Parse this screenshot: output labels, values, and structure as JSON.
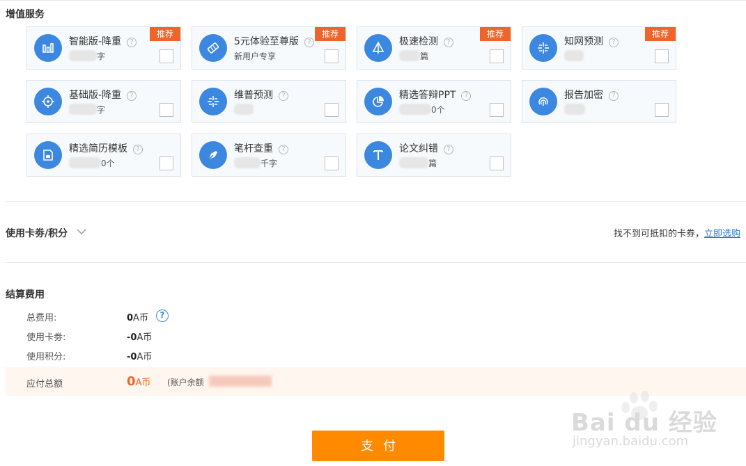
{
  "value_added": {
    "title": "增值服务",
    "services": [
      {
        "name": "智能版-降重",
        "sub": "字",
        "badge": "推荐",
        "icon": "bar-chart-icon"
      },
      {
        "name": "5元体验至尊版",
        "sub": "新用户专享",
        "badge": "推荐",
        "icon": "ticket-icon"
      },
      {
        "name": "极速检测",
        "sub": "篇",
        "badge": "推荐",
        "icon": "sail-icon"
      },
      {
        "name": "知网预测",
        "sub": "",
        "badge": "推荐",
        "icon": "compass-grid-icon"
      },
      {
        "name": "基础版-降重",
        "sub": "字",
        "badge": "",
        "icon": "crosshair-icon"
      },
      {
        "name": "维普预测",
        "sub": "",
        "badge": "",
        "icon": "compass-grid-icon"
      },
      {
        "name": "精选答辩PPT",
        "sub": "0个",
        "badge": "",
        "icon": "pie-chart-icon"
      },
      {
        "name": "报告加密",
        "sub": "",
        "badge": "",
        "icon": "fingerprint-icon"
      },
      {
        "name": "精选简历模板",
        "sub": "0个",
        "badge": "",
        "icon": "document-icon"
      },
      {
        "name": "笔杆查重",
        "sub": "千字",
        "badge": "",
        "icon": "pen-nib-icon"
      },
      {
        "name": "论文纠错",
        "sub": "篇",
        "badge": "",
        "icon": "text-t-icon"
      }
    ],
    "help_glyph": "?"
  },
  "coupon": {
    "title": "使用卡劵/积分",
    "note": "找不到可抵扣的卡券，",
    "link": "立即选购"
  },
  "settlement": {
    "title": "结算费用",
    "rows": [
      {
        "label": "总费用:",
        "num": "0",
        "unit": "A币"
      },
      {
        "label": "使用卡劵:",
        "num": "-0",
        "unit": "A币"
      },
      {
        "label": "使用积分:",
        "num": "-0",
        "unit": "A币"
      }
    ],
    "help_glyph": "?",
    "due_label": "应付总额",
    "due_num": "0",
    "due_unit": "A币",
    "balance_note": "(账户余额"
  },
  "pay_button": "支付",
  "watermark": {
    "text": "Bai du 经验",
    "sub": "jingyan.baidu.com"
  },
  "colors": {
    "accent": "#3c88e0",
    "badge": "#f0642a",
    "pay": "#ff8a00",
    "link": "#2b75c9"
  }
}
